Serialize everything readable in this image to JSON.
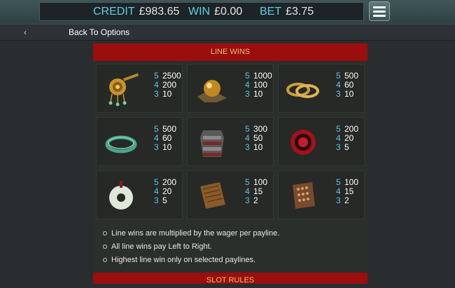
{
  "balance": {
    "credit_label": "CREDIT",
    "credit_value": "£983.65",
    "win_label": "WIN",
    "win_value": "£0.00",
    "bet_label": "BET",
    "bet_value": "£3.75"
  },
  "nav": {
    "back_label": "Back To Options"
  },
  "section": {
    "title": "LINE WINS",
    "next_title": "SLOT RULES"
  },
  "symbols": [
    {
      "icon": "gold-hairpin-icon",
      "pays": [
        {
          "n": "5",
          "v": "2500"
        },
        {
          "n": "4",
          "v": "200"
        },
        {
          "n": "3",
          "v": "10"
        }
      ]
    },
    {
      "icon": "gold-orb-icon",
      "pays": [
        {
          "n": "5",
          "v": "1000"
        },
        {
          "n": "4",
          "v": "100"
        },
        {
          "n": "3",
          "v": "10"
        }
      ]
    },
    {
      "icon": "gold-bracelets-icon",
      "pays": [
        {
          "n": "5",
          "v": "500"
        },
        {
          "n": "4",
          "v": "60"
        },
        {
          "n": "3",
          "v": "10"
        }
      ]
    },
    {
      "icon": "jade-bangle-icon",
      "pays": [
        {
          "n": "5",
          "v": "500"
        },
        {
          "n": "4",
          "v": "60"
        },
        {
          "n": "3",
          "v": "10"
        }
      ]
    },
    {
      "icon": "armor-icon",
      "pays": [
        {
          "n": "5",
          "v": "300"
        },
        {
          "n": "4",
          "v": "50"
        },
        {
          "n": "3",
          "v": "10"
        }
      ]
    },
    {
      "icon": "red-seal-icon",
      "pays": [
        {
          "n": "5",
          "v": "200"
        },
        {
          "n": "4",
          "v": "20"
        },
        {
          "n": "3",
          "v": "5"
        }
      ]
    },
    {
      "icon": "jade-disc-icon",
      "pays": [
        {
          "n": "5",
          "v": "200"
        },
        {
          "n": "4",
          "v": "20"
        },
        {
          "n": "3",
          "v": "5"
        }
      ]
    },
    {
      "icon": "scroll-icon",
      "pays": [
        {
          "n": "5",
          "v": "100"
        },
        {
          "n": "4",
          "v": "15"
        },
        {
          "n": "3",
          "v": "2"
        }
      ]
    },
    {
      "icon": "abacus-icon",
      "pays": [
        {
          "n": "5",
          "v": "100"
        },
        {
          "n": "4",
          "v": "15"
        },
        {
          "n": "3",
          "v": "2"
        }
      ]
    }
  ],
  "rules": [
    "Line wins are multiplied by the wager per payline.",
    "All line wins pay Left to Right.",
    "Highest line win only on selected paylines."
  ]
}
